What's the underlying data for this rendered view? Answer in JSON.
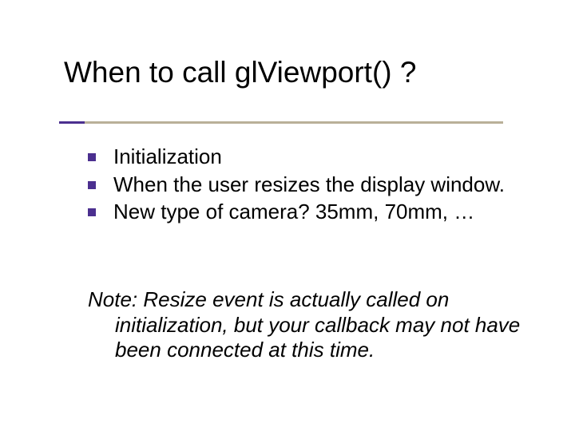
{
  "title": "When to call glViewport() ?",
  "bullets": [
    "Initialization",
    "When the user resizes the display window.",
    "New type of camera? 35mm, 70mm, …"
  ],
  "note": {
    "first_line": "Note: Resize event is actually called on",
    "rest": "initialization, but your callback may not have been connected at this time."
  }
}
